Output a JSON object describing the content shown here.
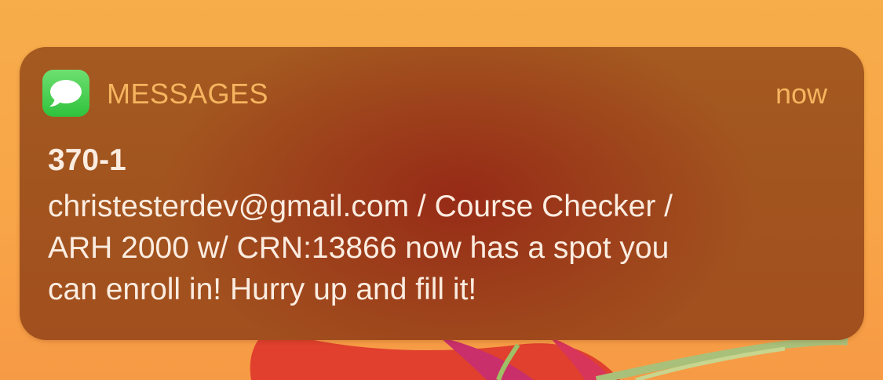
{
  "notification": {
    "app_icon": "messages-bubble-icon",
    "app_name": "MESSAGES",
    "timestamp": "now",
    "title": "370-1",
    "body": "christesterdev@gmail.com / Course Checker /\nARH 2000 w/ CRN:13866 now has a spot you\ncan enroll in! Hurry up and fill it!"
  },
  "colors": {
    "app_icon_green": "#34c23f",
    "header_text": "#f6b45f",
    "body_text": "#fbece0",
    "wallpaper_orange": "#f8a548"
  }
}
